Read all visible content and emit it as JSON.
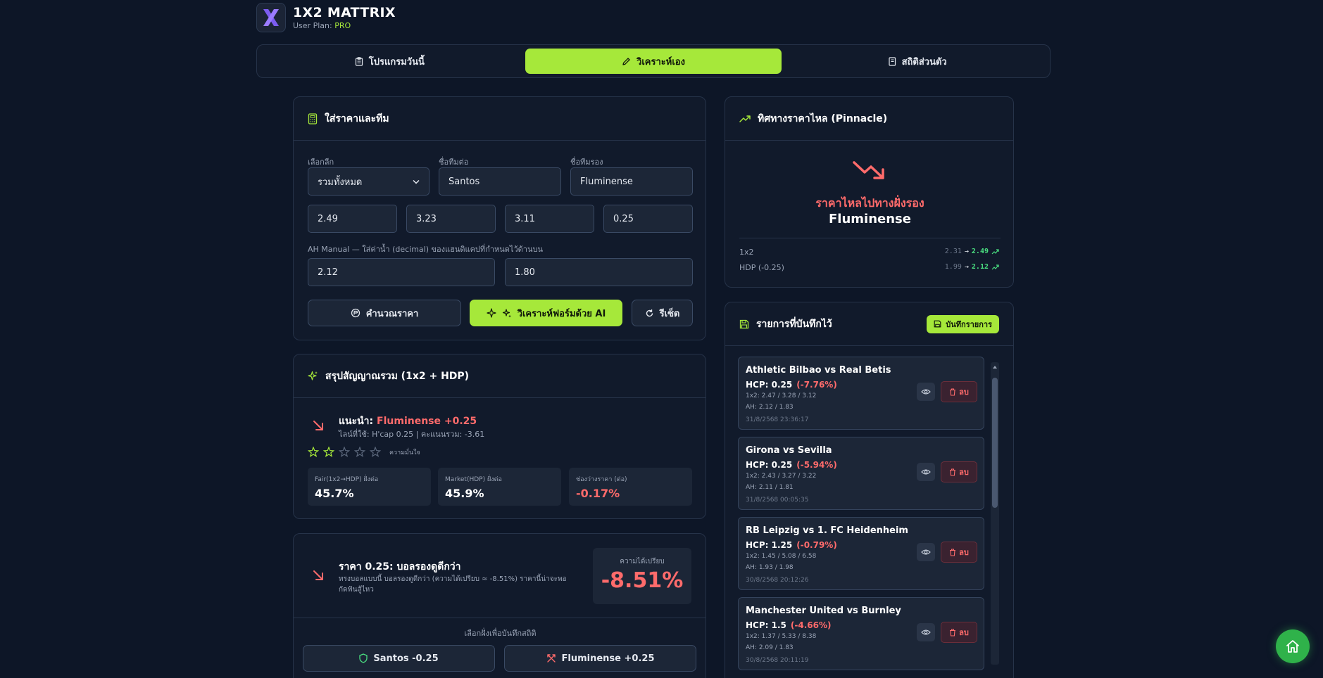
{
  "app": {
    "title": "1X2 MATTRIX",
    "plan_label": "User Plan:",
    "plan_value": "PRO",
    "logo_letter": "X"
  },
  "tabs": [
    {
      "label": "โปรแกรมวันนี้",
      "icon": "clipboard-icon",
      "active": false
    },
    {
      "label": "วิเคราะห์เอง",
      "icon": "pencil-icon",
      "active": true
    },
    {
      "label": "สถิติส่วนตัว",
      "icon": "notebook-icon",
      "active": false
    }
  ],
  "input_card": {
    "title": "ใส่ราคาและทีม",
    "league_label": "เลือกลีก",
    "league_value": "รวมทั้งหมด",
    "home_label": "ชื่อทีมต่อ",
    "home_value": "Santos",
    "away_label": "ชื่อทีมรอง",
    "away_value": "Fluminense",
    "odds": [
      "2.49",
      "3.23",
      "3.11",
      "0.25"
    ],
    "ah_label": "AH Manual — ใส่ค่าน้ำ (decimal) ของแฮนดิแคปที่กำหนดไว้ด้านบน",
    "ah_values": [
      "2.12",
      "1.80"
    ],
    "calc_button": "คำนวณราคา",
    "ai_button": "วิเคราะห์ฟอร์มด้วย AI",
    "reset_button": "รีเซ็ต"
  },
  "summary_card": {
    "title": "สรุปสัญญาณรวม (1x2 + HDP)",
    "recommend_prefix": "แนะนำ:",
    "recommend_pick": "Fluminense +0.25",
    "line_info": "ไลน์ที่ใช้: H'cap 0.25 | คะแนนรวม: -3.61",
    "confidence_label": "ความมั่นใจ",
    "stars": 2,
    "stars_max": 5,
    "stats": [
      {
        "label": "Fair(1x2→HDP) ฝั่งต่อ",
        "value": "45.7%",
        "negative": false
      },
      {
        "label": "Market(HDP) ฝั่งต่อ",
        "value": "45.9%",
        "negative": false
      },
      {
        "label": "ช่องว่างราคา (ต่อ)",
        "value": "-0.17%",
        "negative": true
      }
    ]
  },
  "price_card": {
    "title": "ราคา 0.25: บอลรองดูดีกว่า",
    "desc": "ทรงบอลแบบนี้ บอลรองดูดีกว่า (ความได้เปรียบ ≈ -8.51%) ราคานี้น่าจะพอกัดฟันสู้ไหว",
    "edge_label": "ความได้เปรียบ",
    "edge_value": "-8.51%",
    "pick_label": "เลือกฝั่งเพื่อบันทึกสถิติ",
    "pick_home": "Santos -0.25",
    "pick_away": "Fluminense +0.25"
  },
  "flow_card": {
    "title": "ทิศทางราคาไหล (Pinnacle)",
    "direction_text": "ราคาไหลไปทางฝั่งรอง",
    "team": "Fluminense",
    "rows": [
      {
        "label": "1x2",
        "from": "2.31",
        "to": "2.49"
      },
      {
        "label": "HDP (-0.25)",
        "from": "1.99",
        "to": "2.12"
      }
    ]
  },
  "saved_card": {
    "title": "รายการที่บันทึกไว้",
    "save_button": "บันทึกรายการ",
    "delete_label": "ลบ",
    "items": [
      {
        "match": "Athletic Bilbao vs Real Betis",
        "hcp": "HCP: 0.25",
        "pct": "(-7.76%)",
        "x12": "1x2: 2.47 / 3.28 / 3.12",
        "ah": "AH: 2.12 / 1.83",
        "time": "31/8/2568 23:36:17"
      },
      {
        "match": "Girona vs Sevilla",
        "hcp": "HCP: 0.25",
        "pct": "(-5.94%)",
        "x12": "1x2: 2.43 / 3.27 / 3.22",
        "ah": "AH: 2.11 / 1.81",
        "time": "31/8/2568 00:05:35"
      },
      {
        "match": "RB Leipzig vs 1. FC Heidenheim",
        "hcp": "HCP: 1.25",
        "pct": "(-0.79%)",
        "x12": "1x2: 1.45 / 5.08 / 6.58",
        "ah": "AH: 1.93 / 1.98",
        "time": "30/8/2568 20:12:26"
      },
      {
        "match": "Manchester United vs Burnley",
        "hcp": "HCP: 1.5",
        "pct": "(-4.66%)",
        "x12": "1x2: 1.37 / 5.33 / 8.38",
        "ah": "AH: 2.09 / 1.83",
        "time": "30/8/2568 20:11:19"
      }
    ]
  },
  "colors": {
    "accent": "#a6e83a",
    "negative": "#ff6b6b",
    "positive": "#4ade80",
    "background": "#0d1627"
  }
}
